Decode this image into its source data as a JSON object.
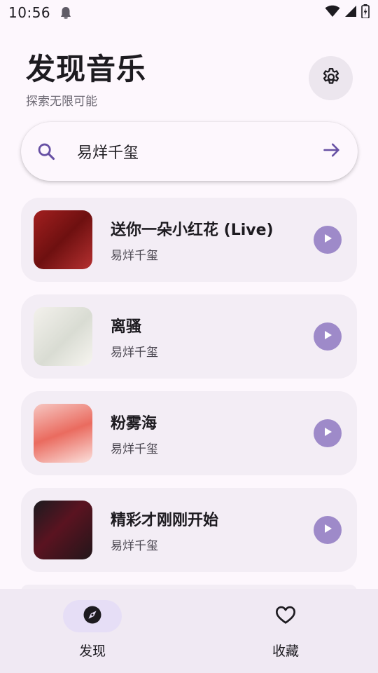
{
  "status_bar": {
    "time": "10:56",
    "icons": [
      "notification-app-icon",
      "wifi-icon",
      "signal-icon",
      "battery-icon"
    ]
  },
  "header": {
    "title": "发现音乐",
    "subtitle": "探索无限可能",
    "settings_icon": "gear-icon"
  },
  "search": {
    "value": "易烊千玺",
    "placeholder": "",
    "search_icon": "search-icon",
    "submit_icon": "arrow-right-icon"
  },
  "songs": [
    {
      "title": "送你一朵小红花 (Live)",
      "artist": "易烊千玺"
    },
    {
      "title": "离骚",
      "artist": "易烊千玺"
    },
    {
      "title": "粉雾海",
      "artist": "易烊千玺"
    },
    {
      "title": "精彩才刚刚开始",
      "artist": "易烊千玺"
    }
  ],
  "bottom_nav": {
    "items": [
      {
        "label": "发现",
        "icon": "compass-icon",
        "selected": true
      },
      {
        "label": "收藏",
        "icon": "heart-icon",
        "selected": false
      }
    ]
  },
  "colors": {
    "background": "#fdf7fd",
    "card": "#f3edf5",
    "accent": "#6750a4",
    "play_button": "#9e8ac9",
    "nav_background": "#f0e9f3",
    "nav_selected": "#e6def6"
  }
}
